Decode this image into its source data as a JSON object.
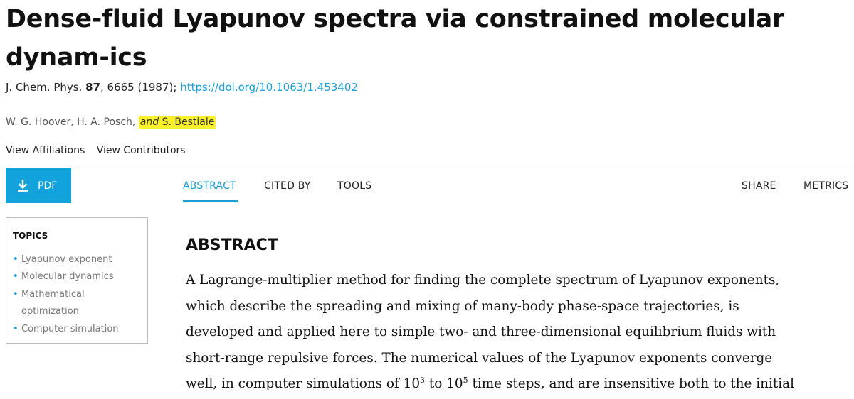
{
  "article": {
    "title": "Dense-fluid Lyapunov spectra via constrained molecular dynam-ics",
    "journal": "J. Chem. Phys.",
    "volume": "87",
    "pages_year": ", 6665 (1987);",
    "doi": "https://doi.org/10.1063/1.453402",
    "authors_plain": "W. G. Hoover, H. A. Posch,",
    "authors_and": "and",
    "authors_last": "S. Bestiale",
    "highlight_color": "#fbf12a"
  },
  "links": {
    "affiliations": "View Affiliations",
    "contributors": "View Contributors"
  },
  "toolbar": {
    "pdf_label": "PDF",
    "tabs": [
      "ABSTRACT",
      "CITED BY",
      "TOOLS"
    ],
    "share": "SHARE",
    "metrics": "METRICS",
    "accent_color": "#1a9fd9"
  },
  "topics": {
    "heading": "TOPICS",
    "items": [
      "Lyapunov exponent",
      "Molecular dynamics",
      "Mathematical",
      "optimization",
      "Computer simulation"
    ]
  },
  "abstract": {
    "heading": "ABSTRACT",
    "line1": "A Lagrange-multiplier method for finding the complete spectrum of Lyapunov exponents,",
    "line2": "which describe the spreading and mixing of many-body phase-space trajectories, is",
    "line3": "developed and applied here to simple two- and three-dimensional equilibrium fluids with",
    "line4": "short-range repulsive forces. The numerical values of the Lyapunov exponents converge",
    "line5_a": "well, in computer simulations of 10",
    "line5_sup1": "3",
    "line5_b": " to 10",
    "line5_sup2": "5",
    "line5_c": " time steps, and are insensitive both to the initial"
  }
}
